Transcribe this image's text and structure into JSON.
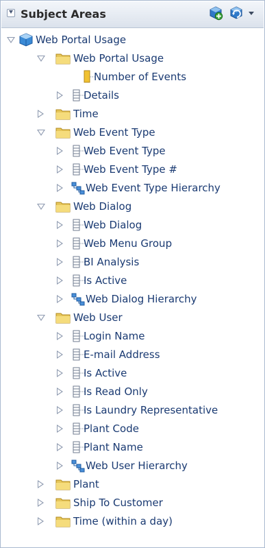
{
  "panel": {
    "title": "Subject Areas",
    "header_icons": [
      "collapse-toggle-icon",
      "add-subject-area-icon",
      "refresh-icon",
      "menu-caret-icon"
    ]
  },
  "tree": [
    {
      "label": "Web Portal Usage",
      "icon": "subject-area-cube-icon",
      "expanded": true
    },
    {
      "label": "Web Portal Usage",
      "icon": "folder-icon",
      "expanded": true
    },
    {
      "label": "Number of Events",
      "icon": "measure-icon"
    },
    {
      "label": "Details",
      "icon": "attribute-column-icon",
      "expanded": false
    },
    {
      "label": "Time",
      "icon": "folder-icon",
      "expanded": false
    },
    {
      "label": "Web Event Type",
      "icon": "folder-icon",
      "expanded": true
    },
    {
      "label": "Web Event Type",
      "icon": "attribute-column-icon",
      "expanded": false
    },
    {
      "label": "Web Event Type #",
      "icon": "attribute-column-icon",
      "expanded": false
    },
    {
      "label": "Web Event Type Hierarchy",
      "icon": "hierarchy-icon",
      "expanded": false
    },
    {
      "label": "Web Dialog",
      "icon": "folder-icon",
      "expanded": true
    },
    {
      "label": "Web Dialog",
      "icon": "attribute-column-icon",
      "expanded": false
    },
    {
      "label": "Web Menu Group",
      "icon": "attribute-column-icon",
      "expanded": false
    },
    {
      "label": "BI Analysis",
      "icon": "attribute-column-icon",
      "expanded": false
    },
    {
      "label": "Is Active",
      "icon": "attribute-column-icon",
      "expanded": false
    },
    {
      "label": "Web Dialog Hierarchy",
      "icon": "hierarchy-icon",
      "expanded": false
    },
    {
      "label": "Web User",
      "icon": "folder-icon",
      "expanded": true
    },
    {
      "label": "Login Name",
      "icon": "attribute-column-icon",
      "expanded": false
    },
    {
      "label": "E-mail Address",
      "icon": "attribute-column-icon",
      "expanded": false
    },
    {
      "label": "Is Active",
      "icon": "attribute-column-icon",
      "expanded": false
    },
    {
      "label": "Is Read Only",
      "icon": "attribute-column-icon",
      "expanded": false
    },
    {
      "label": "Is Laundry Representative",
      "icon": "attribute-column-icon",
      "expanded": false
    },
    {
      "label": "Plant Code",
      "icon": "attribute-column-icon",
      "expanded": false
    },
    {
      "label": "Plant Name",
      "icon": "attribute-column-icon",
      "expanded": false
    },
    {
      "label": "Web User Hierarchy",
      "icon": "hierarchy-icon",
      "expanded": false
    },
    {
      "label": "Plant",
      "icon": "folder-icon",
      "expanded": false
    },
    {
      "label": "Ship To Customer",
      "icon": "folder-icon",
      "expanded": false
    },
    {
      "label": "Time (within a day)",
      "icon": "folder-icon",
      "expanded": false
    }
  ]
}
